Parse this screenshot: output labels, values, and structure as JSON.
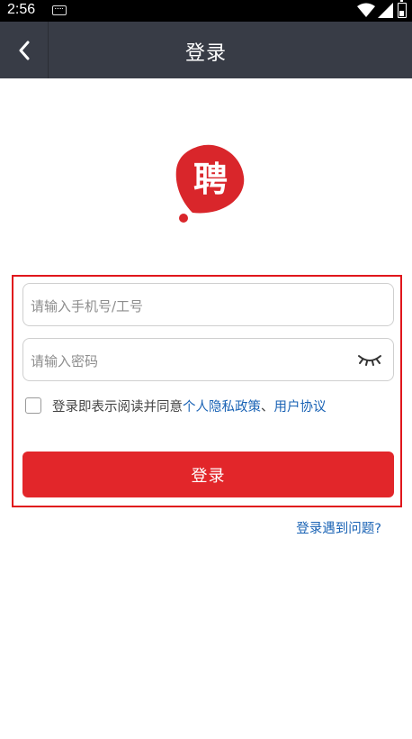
{
  "status_bar": {
    "time": "2:56"
  },
  "nav": {
    "title": "登录"
  },
  "logo": {
    "glyph": "聘",
    "color": "#d9262b"
  },
  "form": {
    "phone_placeholder": "请输入手机号/工号",
    "password_placeholder": "请输入密码",
    "agree_prefix": "登录即表示阅读并同意",
    "privacy_link": "个人隐私政策",
    "separator": "、",
    "user_agreement_link": "用户协议",
    "login_button": "登录",
    "help_link": "登录遇到问题?"
  },
  "colors": {
    "nav_bg": "#383c46",
    "accent_red": "#e2262a",
    "link_blue": "#1a63b5",
    "highlight_border": "#e0161c"
  }
}
